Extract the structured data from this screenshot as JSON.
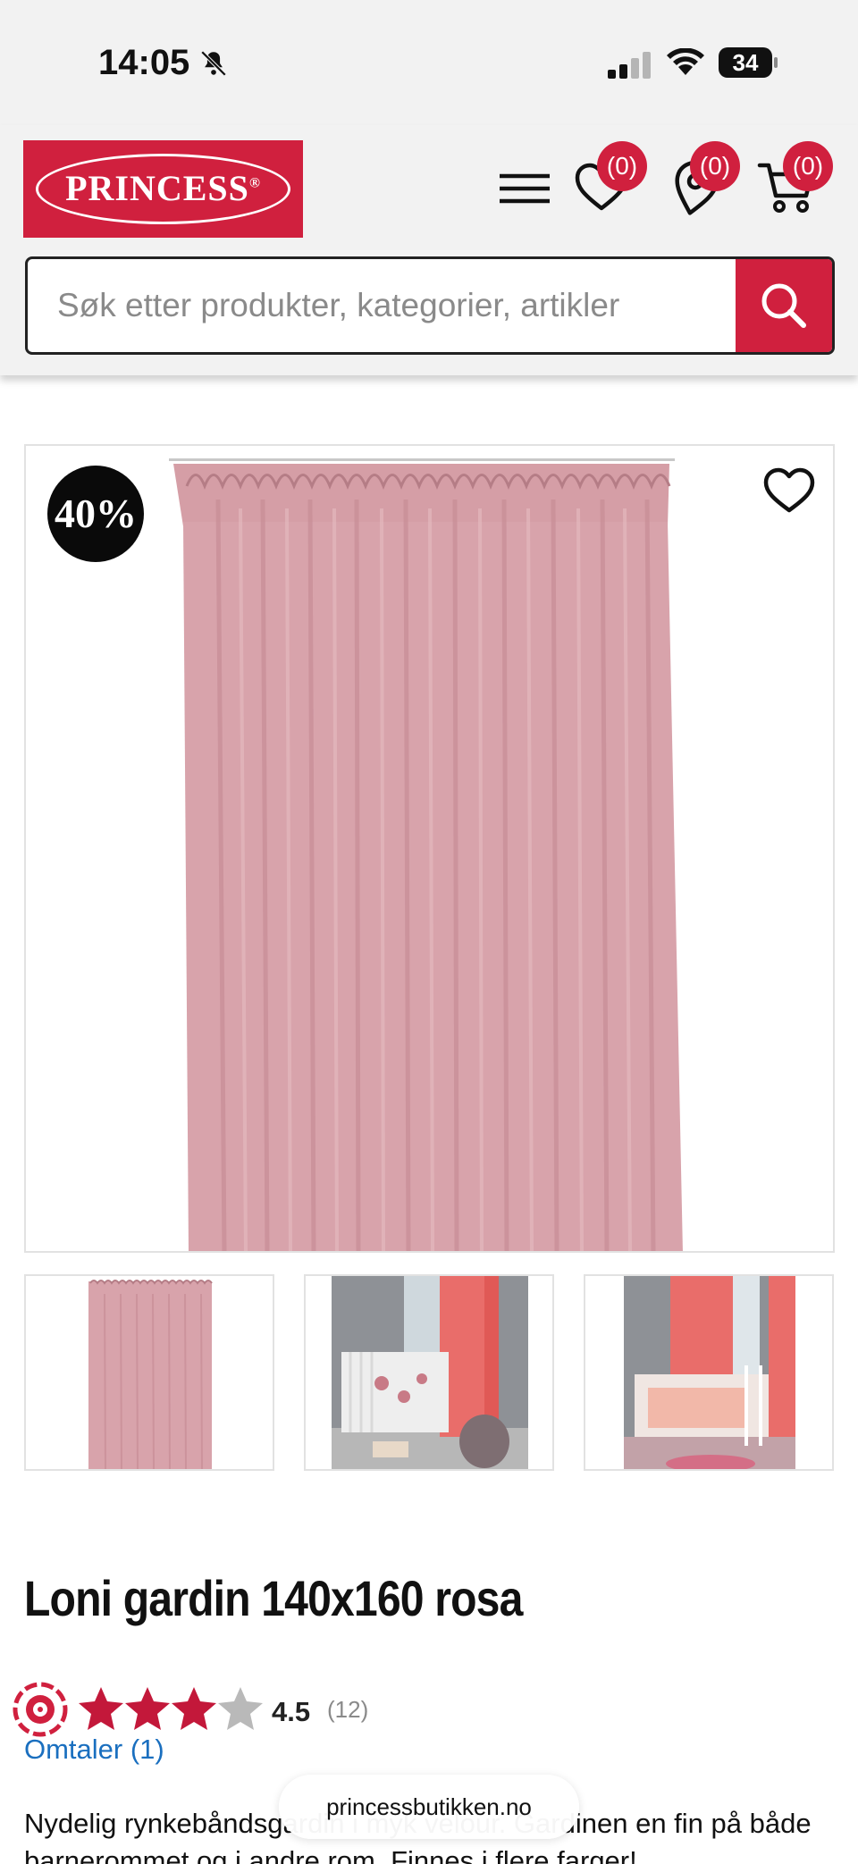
{
  "status_bar": {
    "time": "14:05",
    "battery": "34"
  },
  "header": {
    "logo_text": "PRINCESS",
    "logo_registered": "®",
    "wishlist_count": "(0)",
    "stores_count": "(0)",
    "cart_count": "(0)",
    "search_placeholder": "Søk etter produkter, kategorier, artikler"
  },
  "product": {
    "discount": "40%",
    "title": "Loni gardin 140x160 rosa",
    "rating": "4.5",
    "rating_count": "(12)",
    "rating_value": 4.5,
    "reviews_link": "Omtaler (1)",
    "description": "Nydelig rynkebåndsgardin i myk velour. Gardinen en fin på både barnerommet og i andre rom. Finnes i flere farger!"
  },
  "browser": {
    "url": "princessbutikken.no"
  },
  "colors": {
    "brand": "#d0203e",
    "curtain": "#d9a4ab",
    "link": "#1a6fbf"
  }
}
